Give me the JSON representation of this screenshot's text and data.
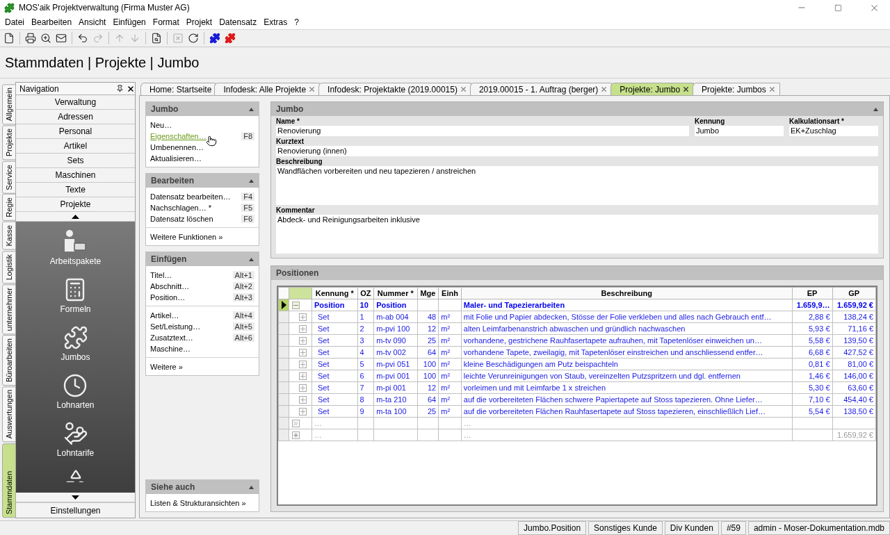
{
  "app": {
    "title": "MOS'aik Projektverwaltung (Firma Muster AG)"
  },
  "menu": [
    {
      "label": "Datei"
    },
    {
      "label": "Bearbeiten"
    },
    {
      "label": "Ansicht"
    },
    {
      "label": "Einfügen"
    },
    {
      "label": "Format"
    },
    {
      "label": "Projekt"
    },
    {
      "label": "Datensatz"
    },
    {
      "label": "Extras"
    },
    {
      "label": "?"
    }
  ],
  "toolbar": [
    {
      "disabled": false
    },
    {
      "disabled": false
    },
    {
      "disabled": false
    },
    {
      "disabled": false
    },
    {
      "disabled": false
    },
    {
      "disabled": true
    },
    {
      "disabled": true
    },
    {
      "disabled": true
    },
    {
      "disabled": false
    },
    {
      "disabled": true
    },
    {
      "disabled": false
    },
    {
      "disabled": false
    },
    {
      "disabled": false
    }
  ],
  "breadcrumb": "Stammdaten | Projekte | Jumbo",
  "side_tabs": [
    {
      "label": "Allgemein",
      "selected": false
    },
    {
      "label": "Projekte",
      "selected": false
    },
    {
      "label": "Service",
      "selected": false
    },
    {
      "label": "Regie",
      "selected": false
    },
    {
      "label": "Kasse",
      "selected": false
    },
    {
      "label": "Logistik",
      "selected": false
    },
    {
      "label": "unternehmer",
      "selected": false
    },
    {
      "label": "Büroarbeiten",
      "selected": false
    },
    {
      "label": "Auswertungen",
      "selected": false
    },
    {
      "label": "Stammdaten",
      "selected": true
    }
  ],
  "navigation": {
    "title": "Navigation",
    "items": [
      {
        "label": "Verwaltung"
      },
      {
        "label": "Adressen"
      },
      {
        "label": "Personal"
      },
      {
        "label": "Artikel"
      },
      {
        "label": "Sets"
      },
      {
        "label": "Maschinen"
      },
      {
        "label": "Texte"
      },
      {
        "label": "Projekte"
      }
    ],
    "tiles": [
      {
        "label": "Arbeitspakete"
      },
      {
        "label": "Formeln"
      },
      {
        "label": "Jumbos"
      },
      {
        "label": "Lohnarten"
      },
      {
        "label": "Lohntarife"
      }
    ],
    "footer": "Einstellungen"
  },
  "doc_tabs": [
    {
      "label": "Home: Startseite",
      "selected": false,
      "closable": false
    },
    {
      "label": "Infodesk: Alle Projekte",
      "selected": false,
      "closable": true
    },
    {
      "label": "Infodesk: Projektakte (2019.00015)",
      "selected": false,
      "closable": true
    },
    {
      "label": "2019.00015 - 1. Auftrag (berger)",
      "selected": false,
      "closable": true
    },
    {
      "label": "Projekte: Jumbo",
      "selected": true,
      "closable": true
    },
    {
      "label": "Projekte: Jumbos",
      "selected": false,
      "closable": true
    }
  ],
  "task_pane": {
    "sections": [
      {
        "title": "Jumbo",
        "expanded": true,
        "groups": [
          [
            {
              "label": "Neu…",
              "hovered": false
            },
            {
              "label": "Eigenschaften…",
              "shortcut": "F8",
              "hovered": true
            },
            {
              "label": "Umbenennen…",
              "hovered": false
            },
            {
              "label": "Aktualisieren…",
              "hovered": false
            }
          ]
        ]
      },
      {
        "title": "Bearbeiten",
        "expanded": true,
        "groups": [
          [
            {
              "label": "Datensatz bearbeiten…",
              "shortcut": "F4",
              "hovered": false
            },
            {
              "label": "Nachschlagen… *",
              "shortcut": "F5",
              "hovered": false
            },
            {
              "label": "Datensatz löschen",
              "shortcut": "F6",
              "hovered": false
            }
          ],
          [
            {
              "label": "Weitere Funktionen »",
              "hovered": false
            }
          ]
        ]
      },
      {
        "title": "Einfügen",
        "expanded": true,
        "groups": [
          [
            {
              "label": "Titel…",
              "shortcut": "Alt+1",
              "hovered": false
            },
            {
              "label": "Abschnitt…",
              "shortcut": "Alt+2",
              "hovered": false
            },
            {
              "label": "Position…",
              "shortcut": "Alt+3",
              "hovered": false
            }
          ],
          [
            {
              "label": "Artikel…",
              "shortcut": "Alt+4",
              "hovered": false
            },
            {
              "label": "Set/Leistung…",
              "shortcut": "Alt+5",
              "hovered": false
            },
            {
              "label": "Zusatztext…",
              "shortcut": "Alt+6",
              "hovered": false
            },
            {
              "label": "Maschine…",
              "hovered": false
            }
          ],
          [
            {
              "label": "Weitere »",
              "hovered": false
            }
          ]
        ]
      }
    ],
    "see_also": {
      "title": "Siehe auch",
      "expanded": true,
      "groups": [
        [
          {
            "label": "Listen & Strukturansichten »",
            "hovered": false
          }
        ]
      ]
    }
  },
  "form": {
    "title": "Jumbo",
    "expanded": true,
    "rows": [
      {
        "fields": [
          {
            "label": "Name *",
            "value": "Renovierung",
            "kind": "line"
          },
          {
            "label": "Kennung",
            "value": "Jumbo",
            "kind": "line"
          },
          {
            "label": "Kalkulationsart *",
            "value": "EK+Zuschlag",
            "kind": "line"
          }
        ]
      },
      {
        "fields": [
          {
            "label": "Kurztext",
            "value": "Renovierung (innen)",
            "kind": "line"
          }
        ]
      },
      {
        "fields": [
          {
            "label": "Beschreibung",
            "value": "Wandflächen vorbereiten und neu tapezieren / anstreichen",
            "kind": "area"
          }
        ]
      },
      {
        "fields": [
          {
            "label": "Kommentar",
            "value": "Abdeck- und Reinigungsarbeiten inklusive",
            "kind": "area"
          }
        ]
      }
    ]
  },
  "positions": {
    "title": "Positionen",
    "columns": [
      {
        "label": "Kennung *"
      },
      {
        "label": "OZ"
      },
      {
        "label": "Nummer *"
      },
      {
        "label": "Mge"
      },
      {
        "label": "Einh"
      },
      {
        "label": "Beschreibung"
      },
      {
        "label": "EP"
      },
      {
        "label": "GP"
      }
    ],
    "rows": [
      {
        "kind": "group",
        "selected": true,
        "expanded": true,
        "cells": [
          "Position",
          "10",
          "Position",
          null,
          null,
          "Maler- und Tapezierarbeiten",
          "1.659,9…",
          "1.659,92 €"
        ]
      },
      {
        "kind": "set",
        "selected": false,
        "expanded": false,
        "cells": [
          "Set",
          "1",
          "m-ab 004",
          "48",
          "m²",
          "mit Folie und Papier abdecken, Stösse der Folie verkleben und alles nach Gebrauch entf…",
          "2,88 €",
          "138,24 €"
        ]
      },
      {
        "kind": "set",
        "selected": false,
        "expanded": false,
        "cells": [
          "Set",
          "2",
          "m-pvi 100",
          "12",
          "m²",
          "alten Leimfarbenanstrich abwaschen und gründlich nachwaschen",
          "5,93 €",
          "71,16 €"
        ]
      },
      {
        "kind": "set",
        "selected": false,
        "expanded": false,
        "cells": [
          "Set",
          "3",
          "m-tv 090",
          "25",
          "m²",
          "vorhandene, gestrichene Rauhfasertapete aufrauhen, mit Tapetenlöser einweichen un…",
          "5,58 €",
          "139,50 €"
        ]
      },
      {
        "kind": "set",
        "selected": false,
        "expanded": false,
        "cells": [
          "Set",
          "4",
          "m-tv 002",
          "64",
          "m²",
          "vorhandene Tapete, zweilagig, mit Tapetenlöser einstreichen und anschliessend entfer…",
          "6,68 €",
          "427,52 €"
        ]
      },
      {
        "kind": "set",
        "selected": false,
        "expanded": false,
        "cells": [
          "Set",
          "5",
          "m-pvi 051",
          "100",
          "m²",
          "kleine Beschädigungen am Putz beispachteln",
          "0,81 €",
          "81,00 €"
        ]
      },
      {
        "kind": "set",
        "selected": false,
        "expanded": false,
        "cells": [
          "Set",
          "6",
          "m-pvi 001",
          "100",
          "m²",
          "leichte Verunreinigungen von Staub, vereinzelten Putzspritzern und dgl. entfernen",
          "1,46 €",
          "146,00 €"
        ]
      },
      {
        "kind": "set",
        "selected": false,
        "expanded": false,
        "cells": [
          "Set",
          "7",
          "m-pi 001",
          "12",
          "m²",
          "vorleimen und mit Leimfarbe 1 x streichen",
          "5,30 €",
          "63,60 €"
        ]
      },
      {
        "kind": "set",
        "selected": false,
        "expanded": false,
        "cells": [
          "Set",
          "8",
          "m-ta 210",
          "64",
          "m²",
          "auf die vorbereiteten Flächen schwere Papiertapete auf Stoss tapezieren. Ohne Liefer…",
          "7,10 €",
          "454,40 €"
        ]
      },
      {
        "kind": "set",
        "selected": false,
        "expanded": false,
        "cells": [
          "Set",
          "9",
          "m-ta 100",
          "25",
          "m²",
          "auf die vorbereiteten Flächen Rauhfasertapete auf Stoss tapezieren, einschließlich Lief…",
          "5,54 €",
          "138,50 €"
        ]
      },
      {
        "kind": "append",
        "selected": false,
        "cells": [
          "…",
          null,
          null,
          null,
          null,
          "…",
          null,
          null
        ]
      },
      {
        "kind": "new",
        "selected": false,
        "cells": [
          "…",
          null,
          null,
          null,
          null,
          "…",
          null,
          "1.659,92 €"
        ]
      }
    ]
  },
  "status_bar": [
    "Jumbo.Position",
    "Sonstiges Kunde",
    "Div Kunden",
    "#59",
    "admin - Moser-Dokumentation.mdb"
  ]
}
